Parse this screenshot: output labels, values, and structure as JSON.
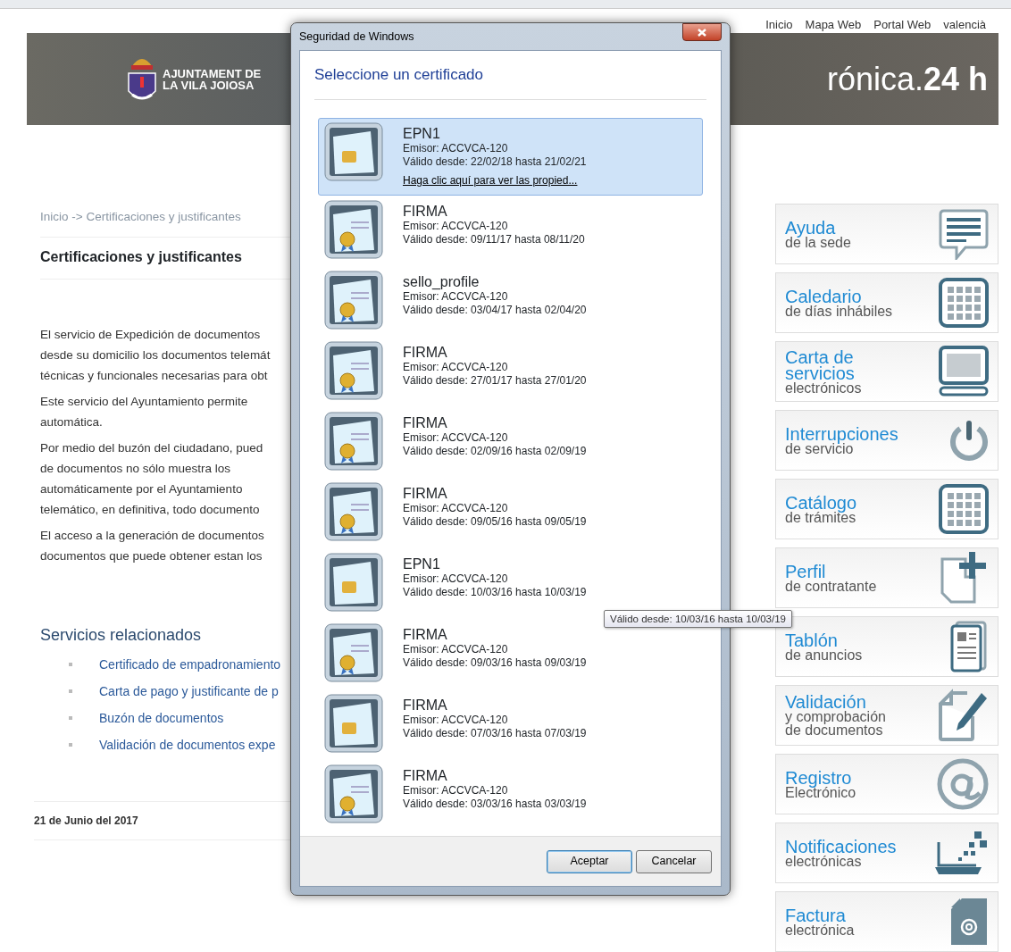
{
  "header": {
    "top_links": [
      "Inicio",
      "Mapa Web",
      "Portal Web",
      "valencià"
    ],
    "logo_lines": [
      "AJUNTAMENT DE",
      "LA VILA JOIOSA"
    ],
    "site_title": "rónica.**24 h**"
  },
  "breadcrumb": "Inicio -> Certificaciones y justificantes",
  "page_title": "Certificaciones y justificantes",
  "paragraphs": [
    [
      "El servicio de Expedición de documentos",
      "desde su domicilio los documentos telemát",
      "técnicas y funcionales necesarias para obt"
    ],
    [
      "Este servicio del Ayuntamiento permite",
      "automática."
    ],
    [
      "Por medio del buzón del ciudadano, pued",
      "de documentos no sólo muestra los",
      "automáticamente por el Ayuntamiento",
      "telemático, en definitiva, todo documento"
    ],
    [
      "El acceso a la generación de documentos",
      "documentos que puede obtener estan los"
    ]
  ],
  "related": {
    "heading": "Servicios relacionados",
    "links": [
      "Certificado de empadronamiento",
      "Carta de pago y justificante de p",
      "Buzón de documentos",
      "Validación de documentos expe"
    ]
  },
  "date": "21 de Junio del 2017",
  "sidebar": [
    {
      "title": "Ayuda",
      "subtitle": "de la sede",
      "kind": "chat"
    },
    {
      "title": "Caledario",
      "subtitle": "de días inhábiles",
      "kind": "grid"
    },
    {
      "title": "Carta de servicios",
      "subtitle": "electrónicos",
      "kind": "monitor"
    },
    {
      "title": "Interrupciones",
      "subtitle": "de servicio",
      "kind": "power"
    },
    {
      "title": "Catálogo",
      "subtitle": "de trámites",
      "kind": "grid"
    },
    {
      "title": "Perfil",
      "subtitle": "de contratante",
      "kind": "docplus"
    },
    {
      "title": "Tablón",
      "subtitle": "de anuncios",
      "kind": "news"
    },
    {
      "title": "Validación",
      "subtitle": "y comprobación\nde documentos",
      "kind": "docpen"
    },
    {
      "title": "Registro",
      "subtitle": "Electrónico",
      "kind": "at"
    },
    {
      "title": "Notificaciones",
      "subtitle": "electrónicas",
      "kind": "laptop"
    },
    {
      "title": "Factura",
      "subtitle": "electrónica",
      "kind": "docat"
    }
  ],
  "dialog": {
    "title": "Seguridad de Windows",
    "heading": "Seleccione un certificado",
    "certificates": [
      {
        "name": "EPN1",
        "issuer": "Emisor: ACCVCA-120",
        "validity": "Válido desde: 22/02/18 hasta 21/02/21",
        "kind": "smartcard",
        "selected": true,
        "link": "Haga clic aquí para ver las propied..."
      },
      {
        "name": "FIRMA",
        "issuer": "Emisor: ACCVCA-120",
        "validity": "Válido desde: 09/11/17 hasta 08/11/20",
        "kind": "seal",
        "selected": false
      },
      {
        "name": "sello_profile",
        "issuer": "Emisor: ACCVCA-120",
        "validity": "Válido desde: 03/04/17 hasta 02/04/20",
        "kind": "seal",
        "selected": false
      },
      {
        "name": "FIRMA",
        "issuer": "Emisor: ACCVCA-120",
        "validity": "Válido desde: 27/01/17 hasta 27/01/20",
        "kind": "seal",
        "selected": false
      },
      {
        "name": "FIRMA",
        "issuer": "Emisor: ACCVCA-120",
        "validity": "Válido desde: 02/09/16 hasta 02/09/19",
        "kind": "seal",
        "selected": false
      },
      {
        "name": "FIRMA",
        "issuer": "Emisor: ACCVCA-120",
        "validity": "Válido desde: 09/05/16 hasta 09/05/19",
        "kind": "seal",
        "selected": false
      },
      {
        "name": "EPN1",
        "issuer": "Emisor: ACCVCA-120",
        "validity": "Válido desde: 10/03/16 hasta 10/03/19",
        "kind": "smartcard",
        "selected": false
      },
      {
        "name": "FIRMA",
        "issuer": "Emisor: ACCVCA-120",
        "validity": "Válido desde: 09/03/16 hasta 09/03/19",
        "kind": "seal",
        "selected": false
      },
      {
        "name": "FIRMA",
        "issuer": "Emisor: ACCVCA-120",
        "validity": "Válido desde: 07/03/16 hasta 07/03/19",
        "kind": "smartcard",
        "selected": false
      },
      {
        "name": "FIRMA",
        "issuer": "Emisor: ACCVCA-120",
        "validity": "Válido desde: 03/03/16 hasta 03/03/19",
        "kind": "seal",
        "selected": false
      }
    ],
    "buttons": [
      {
        "label": "Aceptar",
        "default": true
      },
      {
        "label": "Cancelar",
        "default": false
      }
    ]
  },
  "tooltip": "Válido desde: 10/03/16 hasta 10/03/19"
}
